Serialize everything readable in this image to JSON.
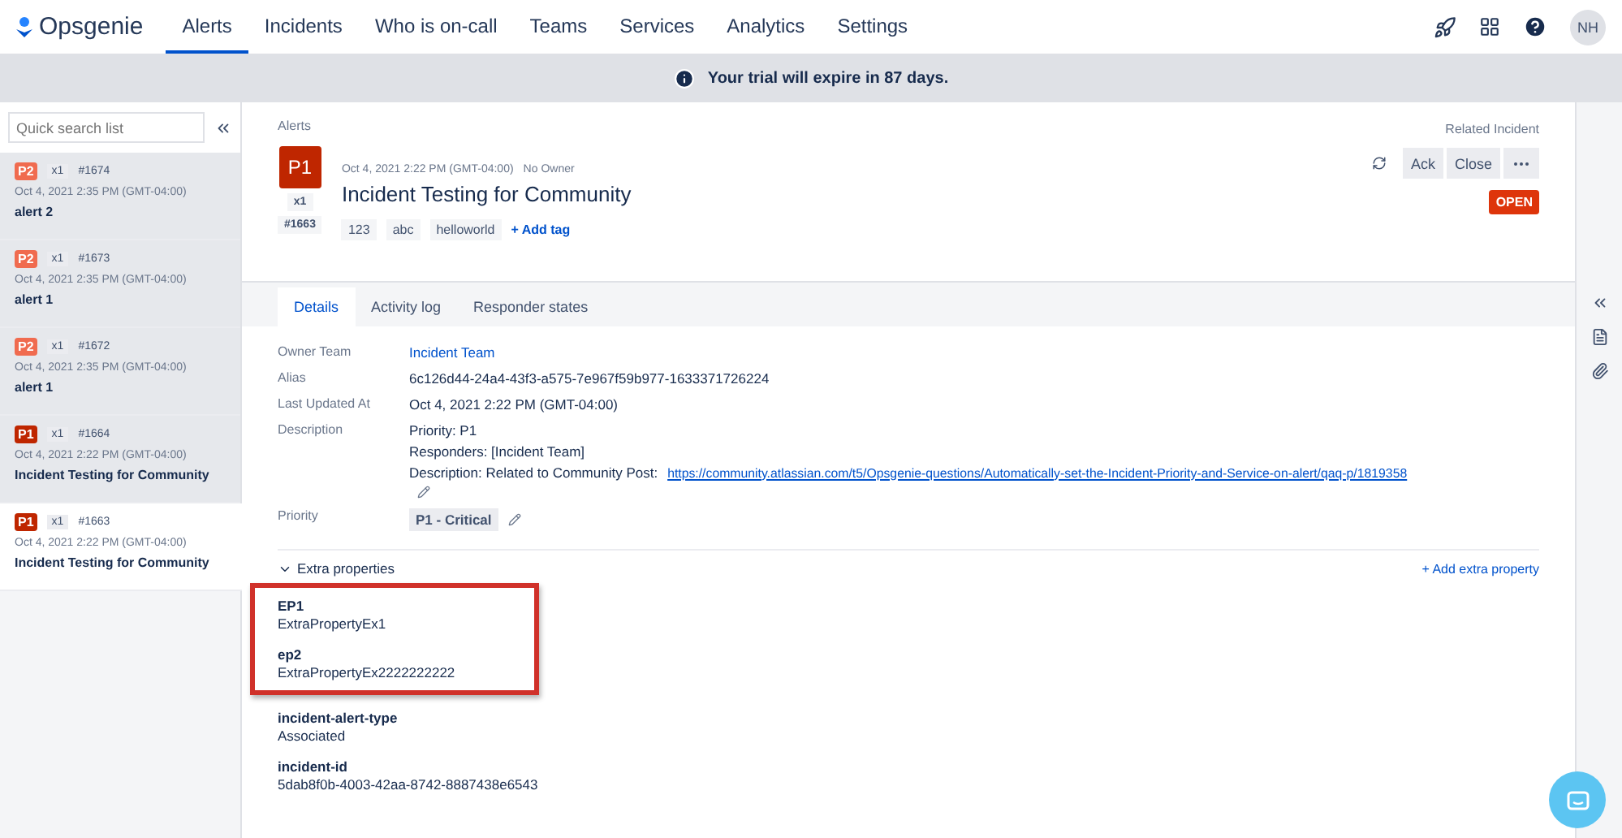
{
  "nav": {
    "brand": "Opsgenie",
    "items": [
      {
        "label": "Alerts",
        "selected": true
      },
      {
        "label": "Incidents",
        "selected": false
      },
      {
        "label": "Who is on-call",
        "selected": false
      },
      {
        "label": "Teams",
        "selected": false
      },
      {
        "label": "Services",
        "selected": false
      },
      {
        "label": "Analytics",
        "selected": false
      },
      {
        "label": "Settings",
        "selected": false
      }
    ],
    "avatar": "NH"
  },
  "banner": {
    "text": "Your trial will expire in 87 days."
  },
  "sidebar": {
    "search": {
      "placeholder": "Quick search list"
    },
    "items": [
      {
        "priority": "P2",
        "color": "#f06b4f",
        "count": "x1",
        "number": "#1674",
        "time": "Oct 4, 2021 2:35 PM (GMT-04:00)",
        "title": "alert 2",
        "selected": false
      },
      {
        "priority": "P2",
        "color": "#f06b4f",
        "count": "x1",
        "number": "#1673",
        "time": "Oct 4, 2021 2:35 PM (GMT-04:00)",
        "title": "alert 1",
        "selected": false
      },
      {
        "priority": "P2",
        "color": "#f06b4f",
        "count": "x1",
        "number": "#1672",
        "time": "Oct 4, 2021 2:35 PM (GMT-04:00)",
        "title": "alert 1",
        "selected": false
      },
      {
        "priority": "P1",
        "color": "#bf2600",
        "count": "x1",
        "number": "#1664",
        "time": "Oct 4, 2021 2:22 PM (GMT-04:00)",
        "title": "Incident Testing for Community",
        "selected": false
      },
      {
        "priority": "P1",
        "color": "#bf2600",
        "count": "x1",
        "number": "#1663",
        "time": "Oct 4, 2021 2:22 PM (GMT-04:00)",
        "title": "Incident Testing for Community",
        "selected": true
      }
    ]
  },
  "alert": {
    "breadcrumb": "Alerts",
    "related": "Related Incident",
    "priority": "P1",
    "count": "x1",
    "number": "#1663",
    "time": "Oct 4, 2021 2:22 PM (GMT-04:00)",
    "owner": "No Owner",
    "title": "Incident Testing for Community",
    "tags": [
      "123",
      "abc",
      "helloworld"
    ],
    "add_tag": "+ Add tag",
    "actions": [
      "Ack",
      "Close"
    ],
    "status": "OPEN"
  },
  "tabs": [
    {
      "label": "Details",
      "selected": true
    },
    {
      "label": "Activity log",
      "selected": false
    },
    {
      "label": "Responder states",
      "selected": false
    }
  ],
  "details": [
    {
      "kind": "link",
      "label": "Owner Team",
      "value": "Incident Team"
    },
    {
      "kind": "text",
      "label": "Alias",
      "value": "6c126d44-24a4-43f3-a575-7e967f59b977-1633371726224"
    },
    {
      "kind": "text",
      "label": "Last Updated At",
      "value": "Oct 4, 2021 2:22 PM (GMT-04:00)"
    },
    {
      "kind": "description",
      "label": "Description",
      "lines": [
        "Priority: P1",
        "Responders: [Incident Team]"
      ],
      "prefix": "Description: Related to Community Post:",
      "link": "https://community.atlassian.com/t5/Opsgenie-questions/Automatically-set-the-Incident-Priority-and-Service-on-alert/qaq-p/1819358"
    },
    {
      "kind": "chip",
      "label": "Priority",
      "value": "P1 - Critical"
    }
  ],
  "extra": {
    "title": "Extra properties",
    "expanded": true,
    "add": "+ Add extra property",
    "highlighted_properties": [
      {
        "key": "EP1",
        "value": "ExtraPropertyEx1"
      },
      {
        "key": "ep2",
        "value": "ExtraPropertyEx2222222222"
      }
    ],
    "properties": [
      {
        "key": "incident-alert-type",
        "value": "Associated"
      },
      {
        "key": "incident-id",
        "value": "5dab8f0b-4003-42aa-8742-8887438e6543"
      }
    ]
  }
}
